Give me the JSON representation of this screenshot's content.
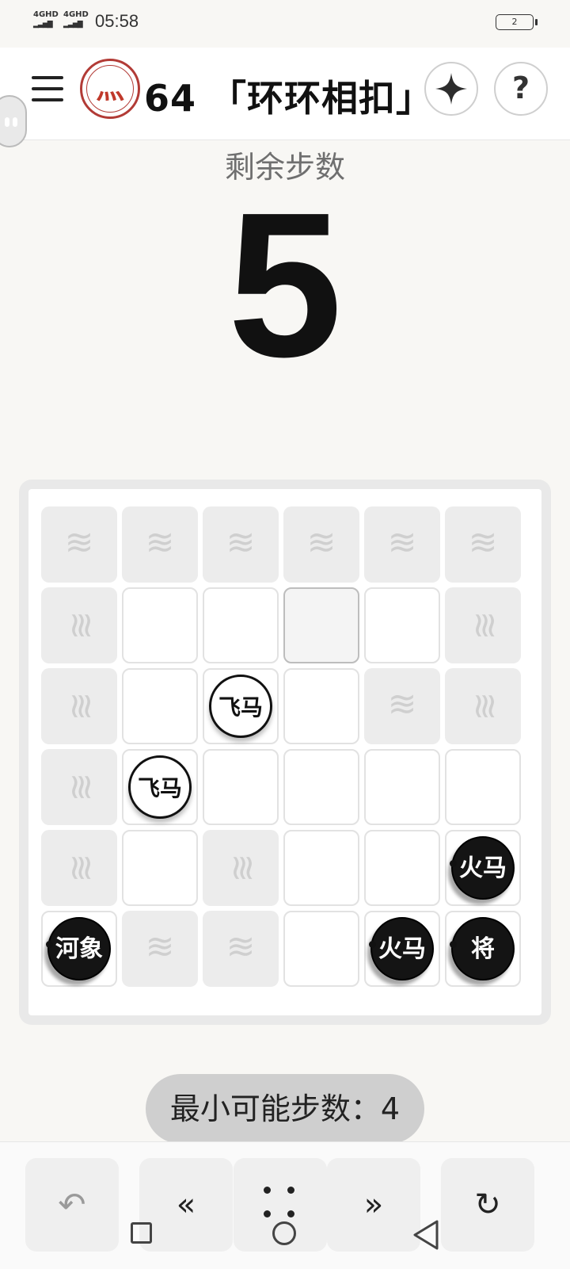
{
  "status_bar": {
    "signal1": "4GHD",
    "signal2": "4GHD",
    "time": "05:58",
    "battery": "2"
  },
  "header": {
    "title": "64 「环环相扣」",
    "help_label": "?"
  },
  "counter": {
    "label": "剩余步数",
    "value": "5"
  },
  "board": {
    "rows": [
      [
        "water-h",
        "water-h",
        "water-h",
        "water-h",
        "water-h",
        "water-h"
      ],
      [
        "water-v",
        "empty",
        "empty",
        "selected",
        "empty",
        "water-v"
      ],
      [
        "water-v",
        "empty",
        "empty",
        "empty",
        "water-h",
        "water-v"
      ],
      [
        "water-v",
        "empty",
        "empty",
        "empty",
        "empty",
        "empty"
      ],
      [
        "water-v",
        "empty",
        "water-v",
        "empty",
        "empty",
        "empty"
      ],
      [
        "empty",
        "water-h",
        "water-h",
        "empty",
        "empty",
        "empty"
      ]
    ],
    "pieces": [
      {
        "label": "飞马",
        "color": "white",
        "row": 2,
        "col": 2
      },
      {
        "label": "飞马",
        "color": "white",
        "row": 3,
        "col": 1
      },
      {
        "label": "火马",
        "color": "black",
        "row": 4,
        "col": 5
      },
      {
        "label": "河象",
        "color": "black",
        "row": 5,
        "col": 0
      },
      {
        "label": "火马",
        "color": "black",
        "row": 5,
        "col": 4
      },
      {
        "label": "将",
        "color": "black",
        "row": 5,
        "col": 5
      }
    ]
  },
  "min_steps": {
    "text": "最小可能步数：4"
  },
  "controls": {
    "undo": "↶",
    "prev": "«",
    "next": "»",
    "reset": "↻"
  }
}
